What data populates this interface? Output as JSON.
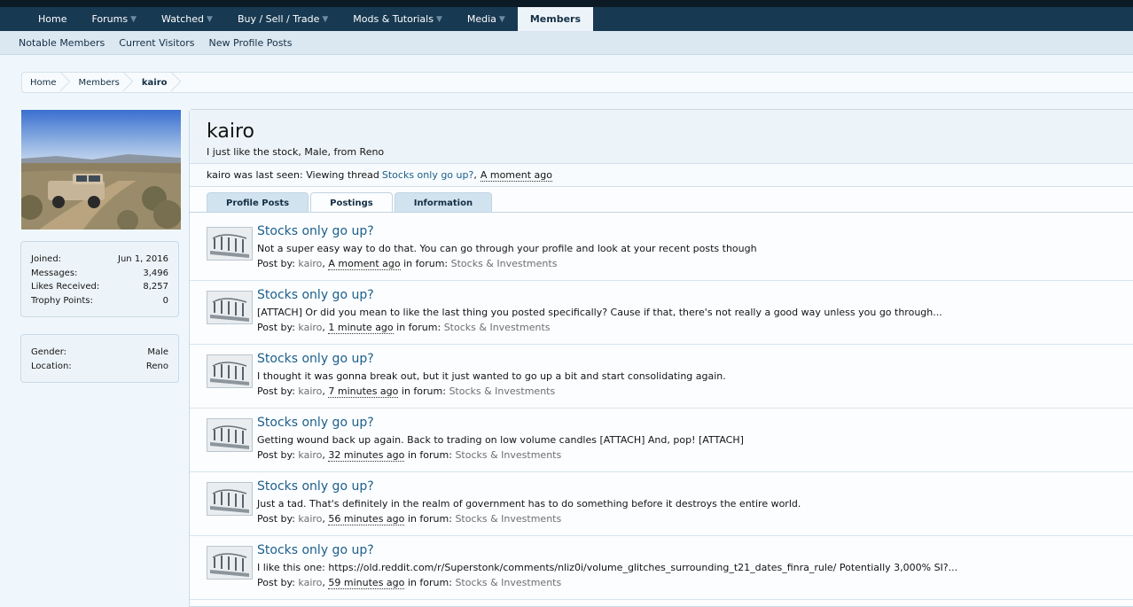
{
  "nav": {
    "tabs": [
      {
        "label": "Home"
      },
      {
        "label": "Forums"
      },
      {
        "label": "Watched"
      },
      {
        "label": "Buy / Sell / Trade"
      },
      {
        "label": "Mods & Tutorials"
      },
      {
        "label": "Media"
      },
      {
        "label": "Members"
      }
    ],
    "subnav": [
      "Notable Members",
      "Current Visitors",
      "New Profile Posts"
    ]
  },
  "breadcrumb": [
    "Home",
    "Members",
    "kairo"
  ],
  "profile": {
    "username": "kairo",
    "tagline": "I just like the stock, Male, from Reno",
    "last_seen_prefix": "kairo was last seen: Viewing thread",
    "last_seen_thread": "Stocks only go up?",
    "last_seen_sep": ",",
    "last_seen_time": "A moment ago"
  },
  "stats": [
    {
      "label": "Joined:",
      "value": "Jun 1, 2016"
    },
    {
      "label": "Messages:",
      "value": "3,496"
    },
    {
      "label": "Likes Received:",
      "value": "8,257"
    },
    {
      "label": "Trophy Points:",
      "value": "0"
    }
  ],
  "info": [
    {
      "label": "Gender:",
      "value": "Male"
    },
    {
      "label": "Location:",
      "value": "Reno"
    }
  ],
  "tabs": [
    "Profile Posts",
    "Postings",
    "Information"
  ],
  "post_meta": {
    "by": "Post by:",
    "in_forum": "in forum:"
  },
  "posts": [
    {
      "title": "Stocks only go up?",
      "snippet": "Not a super easy way to do that. You can go through your profile and look at your recent posts though",
      "user": "kairo",
      "time": "A moment ago",
      "forum": "Stocks & Investments"
    },
    {
      "title": "Stocks only go up?",
      "snippet": "[ATTACH] Or did you mean to like the last thing you posted specifically? Cause if that, there's not really a good way unless you go through...",
      "user": "kairo",
      "time": "1 minute ago",
      "forum": "Stocks & Investments"
    },
    {
      "title": "Stocks only go up?",
      "snippet": "I thought it was gonna break out, but it just wanted to go up a bit and start consolidating again.",
      "user": "kairo",
      "time": "7 minutes ago",
      "forum": "Stocks & Investments"
    },
    {
      "title": "Stocks only go up?",
      "snippet": "Getting wound back up again. Back to trading on low volume candles [ATTACH] And, pop! [ATTACH]",
      "user": "kairo",
      "time": "32 minutes ago",
      "forum": "Stocks & Investments"
    },
    {
      "title": "Stocks only go up?",
      "snippet": "Just a tad. That's definitely in the realm of government has to do something before it destroys the entire world.",
      "user": "kairo",
      "time": "56 minutes ago",
      "forum": "Stocks & Investments"
    },
    {
      "title": "Stocks only go up?",
      "snippet": "I like this one: https://old.reddit.com/r/Superstonk/comments/nliz0i/volume_glitches_surrounding_t21_dates_finra_rule/ Potentially 3,000% SI?...",
      "user": "kairo",
      "time": "59 minutes ago",
      "forum": "Stocks & Investments"
    }
  ]
}
